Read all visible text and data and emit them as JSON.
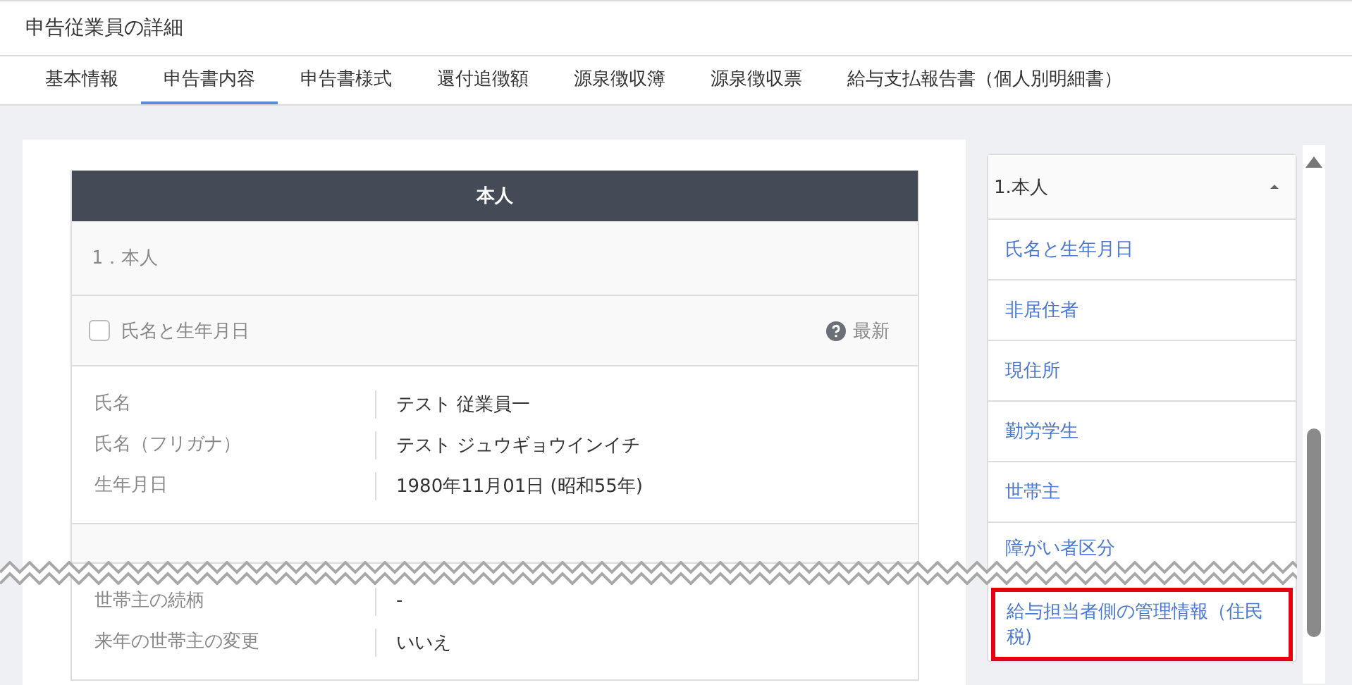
{
  "page_title": "申告従業員の詳細",
  "tabs": [
    {
      "label": "基本情報",
      "selected": false
    },
    {
      "label": "申告書内容",
      "selected": true
    },
    {
      "label": "申告書様式",
      "selected": false
    },
    {
      "label": "還付追徴額",
      "selected": false
    },
    {
      "label": "源泉徴収簿",
      "selected": false
    },
    {
      "label": "源泉徴収票",
      "selected": false
    },
    {
      "label": "給与支払報告書（個人別明細書）",
      "selected": false
    }
  ],
  "card": {
    "header": "本人",
    "section_title": "1．本人",
    "sections": [
      {
        "checkbox_label": "氏名と生年月日",
        "checked": false,
        "status": "最新",
        "fields": [
          {
            "label": "氏名",
            "value": "テスト 従業員一"
          },
          {
            "label": "氏名（フリガナ）",
            "value": "テスト ジュウギョウインイチ"
          },
          {
            "label": "生年月日",
            "value": "1980年11月01日 (昭和55年)"
          }
        ]
      },
      {
        "fields": [
          {
            "label": "世帯主の続柄",
            "value": "-"
          },
          {
            "label": "来年の世帯主の変更",
            "value": "いいえ"
          }
        ]
      }
    ]
  },
  "sidebar": {
    "dropdown": {
      "label": "1.本人",
      "expanded": true
    },
    "items": [
      {
        "label": "氏名と生年月日",
        "highlighted": false
      },
      {
        "label": "非居住者",
        "highlighted": false
      },
      {
        "label": "現住所",
        "highlighted": false
      },
      {
        "label": "勤労学生",
        "highlighted": false
      },
      {
        "label": "世帯主",
        "highlighted": false
      },
      {
        "label": "障がい者区分",
        "highlighted": false
      },
      {
        "label": "給与担当者側の管理情報（住民税)",
        "highlighted": true
      }
    ]
  }
}
